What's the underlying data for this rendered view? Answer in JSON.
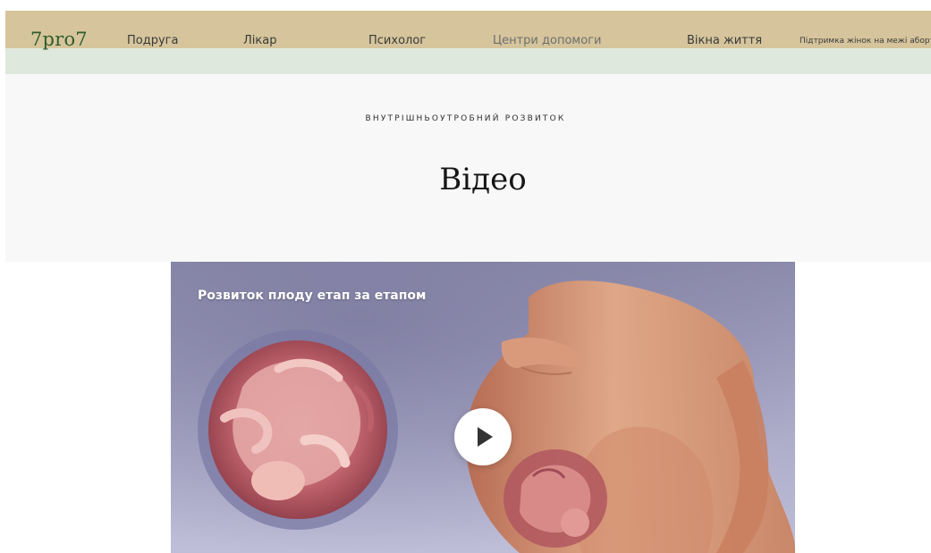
{
  "header": {
    "logo": "7pro7",
    "nav": [
      {
        "label": "Подруга"
      },
      {
        "label": "Лікар"
      },
      {
        "label": "Психолог"
      },
      {
        "label": "Центри допомоги"
      },
      {
        "label": "Вікна життя"
      },
      {
        "label": "Підтримка жінок на межі аборту"
      }
    ],
    "colors": {
      "nav_bg": "#d6c59c",
      "sub_bg": "#dfe8dc",
      "logo": "#2f5d2a"
    }
  },
  "hero": {
    "eyebrow": "ВНУТРІШНЬОУТРОБНИЙ РОЗВИТОК",
    "title": "Відео"
  },
  "video": {
    "title": "Розвиток плоду етап за етапом",
    "play_icon": "play-icon"
  }
}
